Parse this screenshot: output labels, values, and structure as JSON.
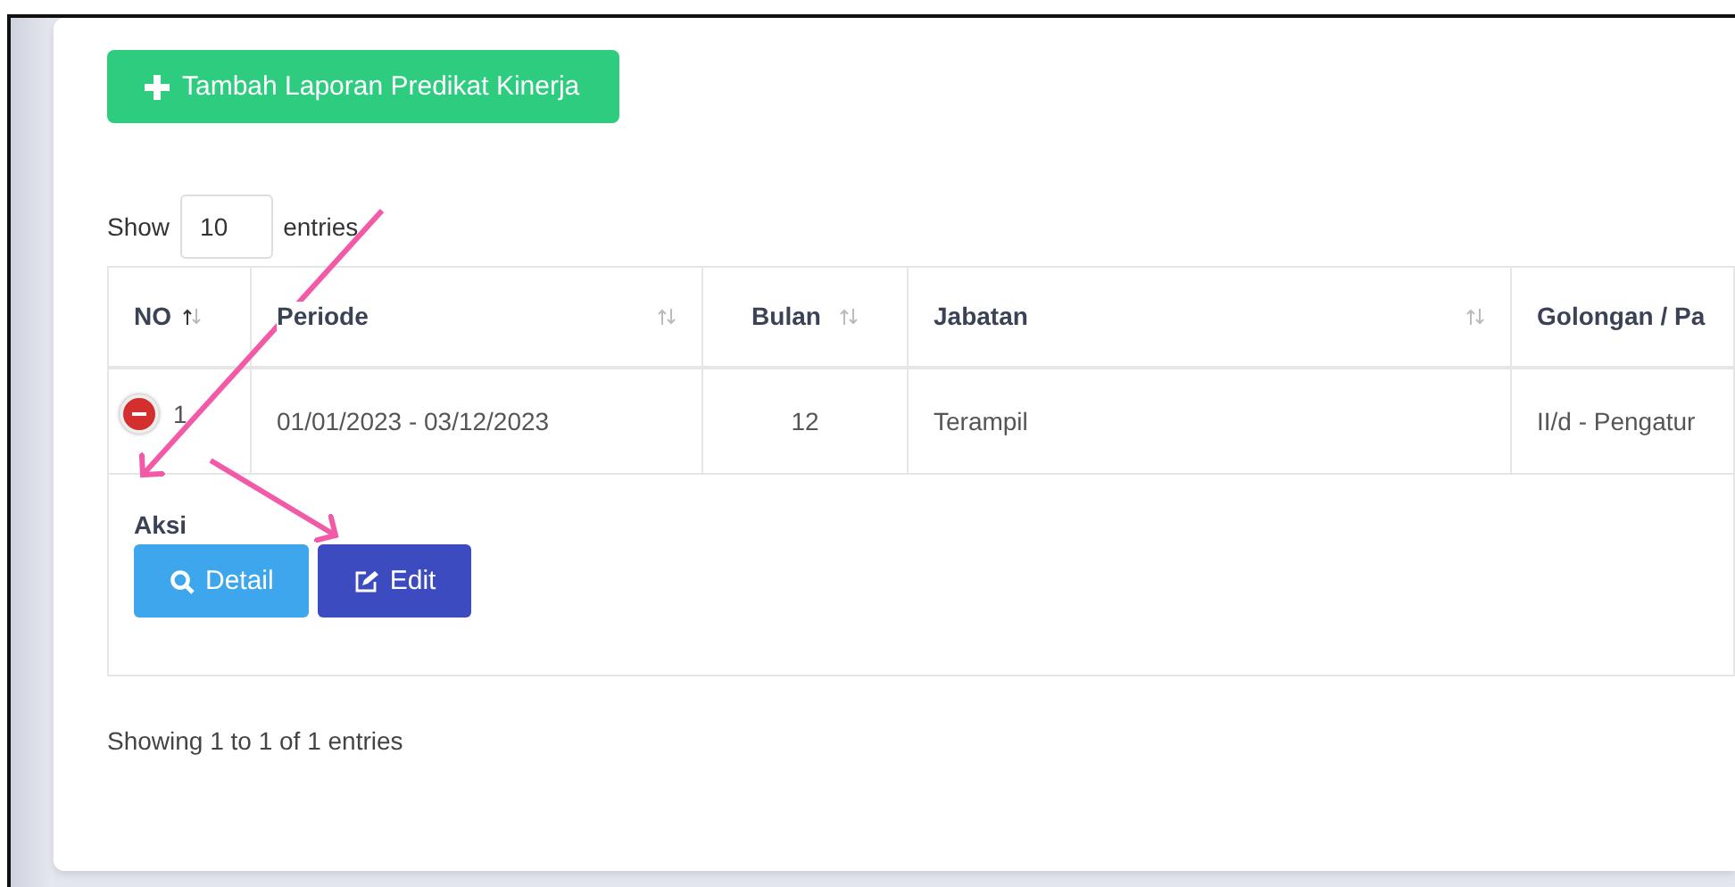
{
  "add_button": {
    "label": "Tambah Laporan Predikat Kinerja"
  },
  "length_control": {
    "prefix": "Show",
    "value": "10",
    "suffix": "entries"
  },
  "table": {
    "columns": [
      {
        "label": "NO",
        "sorted": true
      },
      {
        "label": "Periode",
        "sorted": false
      },
      {
        "label": "Bulan",
        "sorted": false
      },
      {
        "label": "Jabatan",
        "sorted": false
      },
      {
        "label": "Golongan / Pa"
      }
    ],
    "rows": [
      {
        "expanded": true,
        "cells": [
          "1",
          "01/01/2023 - 03/12/2023",
          "12",
          "Terampil",
          "II/d - Pengatur"
        ],
        "details": {
          "label": "Aksi",
          "buttons": [
            {
              "label": "Detail",
              "kind": "detail"
            },
            {
              "label": "Edit",
              "kind": "edit"
            }
          ]
        }
      }
    ]
  },
  "info": "Showing 1 to 1 of 1 entries"
}
